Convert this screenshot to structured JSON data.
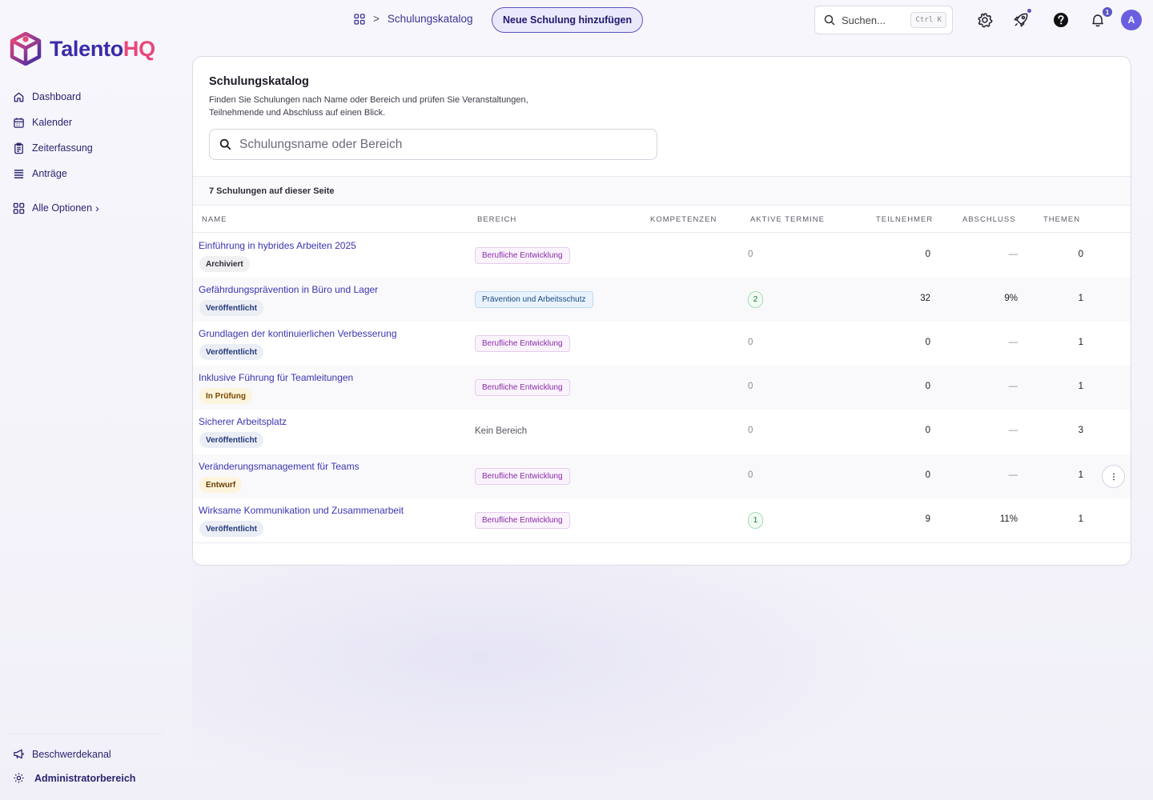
{
  "app": {
    "brand_main": "Talento",
    "brand_accent": "HQ",
    "colors": {
      "primary": "#3a2ba8",
      "accent": "#e8477a",
      "link": "#3b34b0"
    }
  },
  "sidebar": {
    "items": [
      {
        "label": "Dashboard",
        "icon": "home-icon"
      },
      {
        "label": "Kalender",
        "icon": "calendar-icon"
      },
      {
        "label": "Zeiterfassung",
        "icon": "clipboard-icon"
      },
      {
        "label": "Anträge",
        "icon": "list-icon"
      },
      {
        "label": "Alle Optionen",
        "icon": "grid-icon"
      }
    ],
    "all_options_chevron": "›",
    "bottom": [
      {
        "label": "Beschwerdekanal",
        "icon": "megaphone-icon"
      },
      {
        "label": "Administratorbereich",
        "icon": "gear-icon"
      }
    ]
  },
  "header": {
    "breadcrumb_separator": ">",
    "breadcrumb_current": "Schulungskatalog",
    "new_button": "Neue Schulung hinzufügen",
    "search_placeholder": "Suchen...",
    "search_shortcut": "Ctrl K",
    "notification_count": "1",
    "avatar_initial": "A",
    "icons": [
      "settings-icon",
      "rocket-icon",
      "help-icon",
      "bell-icon"
    ]
  },
  "main": {
    "title": "Schulungskatalog",
    "description": "Finden Sie Schulungen nach Name oder Bereich und prüfen Sie Veranstaltungen, Teilnehmende und Abschluss auf einen Blick.",
    "search_placeholder": "Schulungsname oder Bereich",
    "count_text": "7 Schulungen auf dieser Seite",
    "columns": [
      "Name",
      "Bereich",
      "Kompetenzen",
      "Aktive Termine",
      "Teilnehmer",
      "Abschluss",
      "Themen"
    ],
    "rows": [
      {
        "name": "Einführung in hybrides Arbeiten 2025",
        "status": "Archiviert",
        "status_type": "archived",
        "area": "Berufliche Entwicklung",
        "area_type": "pd",
        "termine": "0",
        "termine_badge": false,
        "teilnehmer": "0",
        "abschluss": "—",
        "themen": "0"
      },
      {
        "name": "Gefährdungsprävention in Büro und Lager",
        "status": "Veröffentlicht",
        "status_type": "published",
        "area": "Prävention und Arbeitsschutz",
        "area_type": "pr",
        "termine": "2",
        "termine_badge": true,
        "teilnehmer": "32",
        "abschluss": "9%",
        "themen": "1"
      },
      {
        "name": "Grundlagen der kontinuierlichen Verbesserung",
        "status": "Veröffentlicht",
        "status_type": "published",
        "area": "Berufliche Entwicklung",
        "area_type": "pd",
        "termine": "0",
        "termine_badge": false,
        "teilnehmer": "0",
        "abschluss": "—",
        "themen": "1"
      },
      {
        "name": "Inklusive Führung für Teamleitungen",
        "status": "In Prüfung",
        "status_type": "review",
        "area": "Berufliche Entwicklung",
        "area_type": "pd",
        "termine": "0",
        "termine_badge": false,
        "teilnehmer": "0",
        "abschluss": "—",
        "themen": "1"
      },
      {
        "name": "Sicherer Arbeitsplatz",
        "status": "Veröffentlicht",
        "status_type": "published",
        "area": "Kein Bereich",
        "area_type": "none",
        "termine": "0",
        "termine_badge": false,
        "teilnehmer": "0",
        "abschluss": "—",
        "themen": "3"
      },
      {
        "name": "Veränderungsmanagement für Teams",
        "status": "Entwurf",
        "status_type": "draft",
        "area": "Berufliche Entwicklung",
        "area_type": "pd",
        "termine": "0",
        "termine_badge": false,
        "teilnehmer": "0",
        "abschluss": "—",
        "themen": "1",
        "has_menu": true
      },
      {
        "name": "Wirksame Kommunikation und Zusammenarbeit",
        "status": "Veröffentlicht",
        "status_type": "published",
        "area": "Berufliche Entwicklung",
        "area_type": "pd",
        "termine": "1",
        "termine_badge": true,
        "teilnehmer": "9",
        "abschluss": "11%",
        "themen": "1"
      }
    ]
  }
}
